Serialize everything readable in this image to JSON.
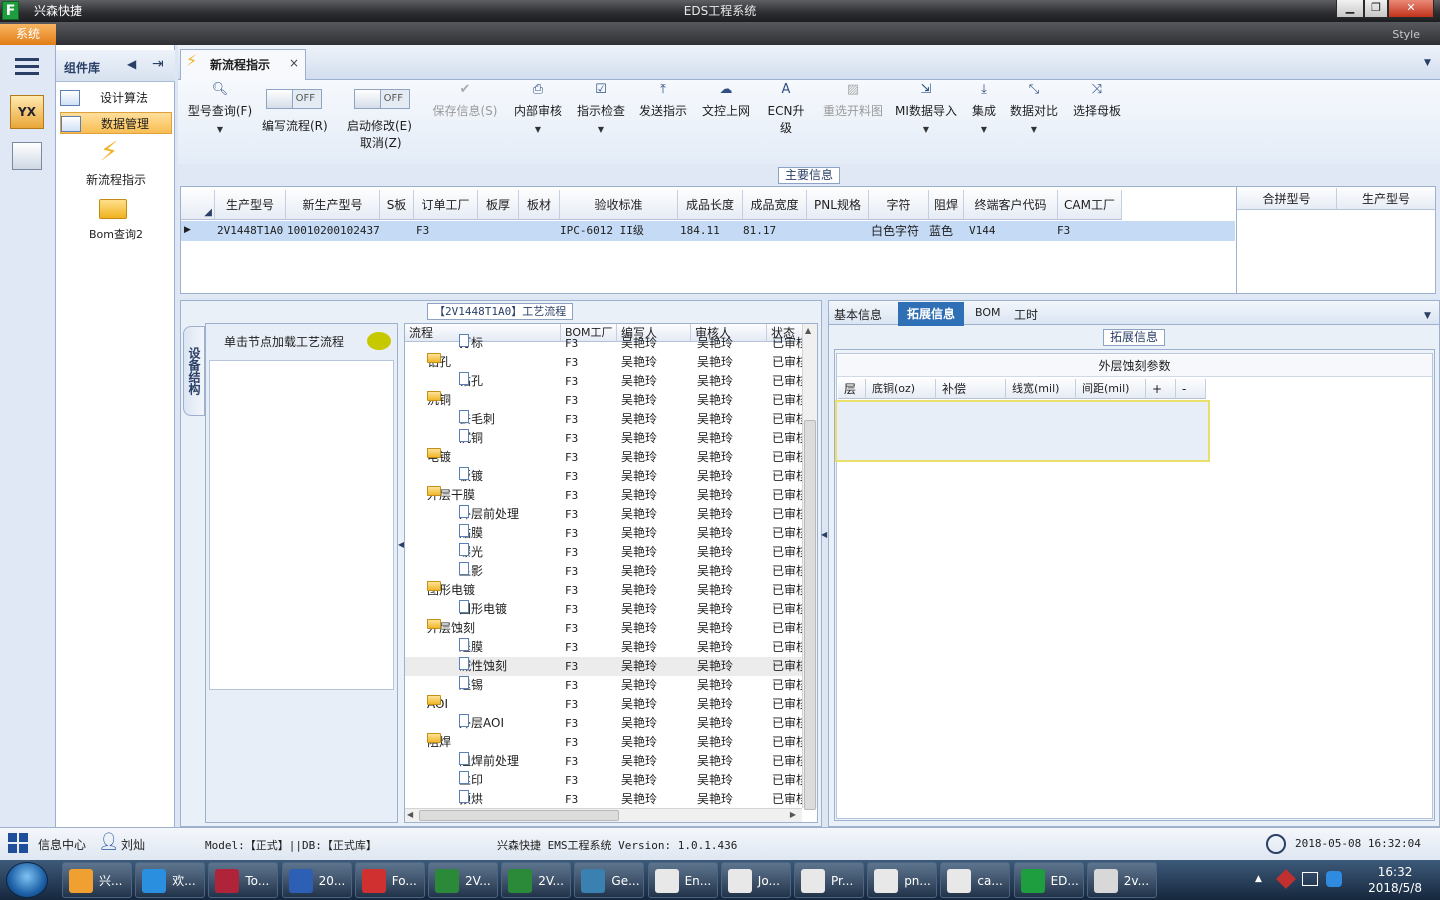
{
  "window": {
    "app_name": "兴森快捷",
    "title": "EDS工程系统",
    "logo_letter": "F"
  },
  "menu": {
    "system_tab": "系统",
    "style_label": "Style"
  },
  "component_panel": {
    "header": "组件库",
    "items": [
      "设计算法",
      "数据管理"
    ],
    "launchers": [
      "新流程指示",
      "Bom查询2"
    ]
  },
  "tab": {
    "label": "新流程指示",
    "close": "×"
  },
  "ribbon": {
    "buttons": [
      {
        "label": "型号查询(F)"
      },
      {
        "label": "编写流程(R)",
        "state": "OFF"
      },
      {
        "label": "启动修改(E)",
        "sub": "取消(Z)",
        "state": "OFF"
      },
      {
        "label": "保存信息(S)"
      },
      {
        "label": "内部审核"
      },
      {
        "label": "指示检查"
      },
      {
        "label": "发送指示"
      },
      {
        "label": "文控上网"
      },
      {
        "label": "ECN升级"
      },
      {
        "label": "重选开料图"
      },
      {
        "label": "MI数据导入"
      },
      {
        "label": "集成"
      },
      {
        "label": "数据对比"
      },
      {
        "label": "选择母板"
      }
    ]
  },
  "main_info": {
    "label": "主要信息",
    "columns": [
      "生产型号",
      "新生产型号",
      "S板",
      "订单工厂",
      "板厚",
      "板材",
      "验收标准",
      "成品长度",
      "成品宽度",
      "PNL规格",
      "字符",
      "阻焊",
      "终端客户代码",
      "CAM工厂"
    ],
    "row": [
      "2V1448T1A0",
      "10010200102437",
      "",
      "F3",
      "",
      "",
      "IPC-6012 II级",
      "184.11",
      "81.17",
      "",
      "白色字符",
      "蓝色",
      "V144",
      "F3"
    ],
    "side_columns": [
      "合拼型号",
      "生产型号"
    ]
  },
  "process": {
    "label": "【2V1448T1A0】工艺流程",
    "vertical_tab": "设备结构",
    "node_hint": "单击节点加载工艺流程",
    "columns": [
      "流程",
      "BOM工厂",
      "编写人",
      "审核人",
      "状态"
    ],
    "rows": [
      {
        "name": "打标",
        "level": 1,
        "factory": "F3",
        "writer": "吴艳玲",
        "reviewer": "吴艳玲",
        "status": "已审核"
      },
      {
        "name": "钻孔",
        "level": 0,
        "factory": "F3",
        "writer": "吴艳玲",
        "reviewer": "吴艳玲",
        "status": "已审核"
      },
      {
        "name": "钻孔",
        "level": 1,
        "factory": "F3",
        "writer": "吴艳玲",
        "reviewer": "吴艳玲",
        "status": "已审核"
      },
      {
        "name": "沉铜",
        "level": 0,
        "factory": "F3",
        "writer": "吴艳玲",
        "reviewer": "吴艳玲",
        "status": "已审核"
      },
      {
        "name": "去毛刺",
        "level": 1,
        "factory": "F3",
        "writer": "吴艳玲",
        "reviewer": "吴艳玲",
        "status": "已审核"
      },
      {
        "name": "沉铜",
        "level": 1,
        "factory": "F3",
        "writer": "吴艳玲",
        "reviewer": "吴艳玲",
        "status": "已审核"
      },
      {
        "name": "电镀",
        "level": 0,
        "factory": "F3",
        "writer": "吴艳玲",
        "reviewer": "吴艳玲",
        "status": "已审核"
      },
      {
        "name": "板镀",
        "level": 1,
        "factory": "F3",
        "writer": "吴艳玲",
        "reviewer": "吴艳玲",
        "status": "已审核"
      },
      {
        "name": "外层干膜",
        "level": 0,
        "factory": "F3",
        "writer": "吴艳玲",
        "reviewer": "吴艳玲",
        "status": "已审核"
      },
      {
        "name": "外层前处理",
        "level": 1,
        "factory": "F3",
        "writer": "吴艳玲",
        "reviewer": "吴艳玲",
        "status": "已审核"
      },
      {
        "name": "贴膜",
        "level": 1,
        "factory": "F3",
        "writer": "吴艳玲",
        "reviewer": "吴艳玲",
        "status": "已审核"
      },
      {
        "name": "曝光",
        "level": 1,
        "factory": "F3",
        "writer": "吴艳玲",
        "reviewer": "吴艳玲",
        "status": "已审核"
      },
      {
        "name": "显影",
        "level": 1,
        "factory": "F3",
        "writer": "吴艳玲",
        "reviewer": "吴艳玲",
        "status": "已审核"
      },
      {
        "name": "图形电镀",
        "level": 0,
        "factory": "F3",
        "writer": "吴艳玲",
        "reviewer": "吴艳玲",
        "status": "已审核"
      },
      {
        "name": "图形电镀",
        "level": 1,
        "factory": "F3",
        "writer": "吴艳玲",
        "reviewer": "吴艳玲",
        "status": "已审核"
      },
      {
        "name": "外层蚀刻",
        "level": 0,
        "factory": "F3",
        "writer": "吴艳玲",
        "reviewer": "吴艳玲",
        "status": "已审核"
      },
      {
        "name": "退膜",
        "level": 1,
        "factory": "F3",
        "writer": "吴艳玲",
        "reviewer": "吴艳玲",
        "status": "已审核"
      },
      {
        "name": "碱性蚀刻",
        "level": 1,
        "factory": "F3",
        "writer": "吴艳玲",
        "reviewer": "吴艳玲",
        "status": "已审核",
        "selected": true
      },
      {
        "name": "退锡",
        "level": 1,
        "factory": "F3",
        "writer": "吴艳玲",
        "reviewer": "吴艳玲",
        "status": "已审核"
      },
      {
        "name": "AOI",
        "level": 0,
        "factory": "F3",
        "writer": "吴艳玲",
        "reviewer": "吴艳玲",
        "status": "已审核"
      },
      {
        "name": "外层AOI",
        "level": 1,
        "factory": "F3",
        "writer": "吴艳玲",
        "reviewer": "吴艳玲",
        "status": "已审核"
      },
      {
        "name": "阻焊",
        "level": 0,
        "factory": "F3",
        "writer": "吴艳玲",
        "reviewer": "吴艳玲",
        "status": "已审核"
      },
      {
        "name": "阻焊前处理",
        "level": 1,
        "factory": "F3",
        "writer": "吴艳玲",
        "reviewer": "吴艳玲",
        "status": "已审核"
      },
      {
        "name": "丝印",
        "level": 1,
        "factory": "F3",
        "writer": "吴艳玲",
        "reviewer": "吴艳玲",
        "status": "已审核"
      },
      {
        "name": "预烘",
        "level": 1,
        "factory": "F3",
        "writer": "吴艳玲",
        "reviewer": "吴艳玲",
        "status": "已审核"
      }
    ]
  },
  "detail": {
    "tabs": [
      "基本信息",
      "拓展信息",
      "BOM",
      "工时"
    ],
    "active_tab": "拓展信息",
    "section_label": "拓展信息",
    "table_title": "外层蚀刻参数",
    "columns": [
      "层",
      "底铜(oz)",
      "补偿",
      "线宽(mil)",
      "间距(mil)",
      "+",
      "-"
    ]
  },
  "status_bar": {
    "info_center": "信息中心",
    "user": "刘灿",
    "model_db": "Model:【正式】||DB:【正式库】",
    "version": "兴森快捷  EMS工程系统  Version: 1.0.1.436",
    "datetime": "2018-05-08 16:32:04"
  },
  "taskbar": {
    "items": [
      "兴...",
      "欢...",
      "To...",
      "20...",
      "Fo...",
      "2V...",
      "2V...",
      "Ge...",
      "En...",
      "Jo...",
      "Pr...",
      "pn...",
      "ca...",
      "ED...",
      "2v..."
    ],
    "time": "16:32",
    "date": "2018/5/8"
  }
}
